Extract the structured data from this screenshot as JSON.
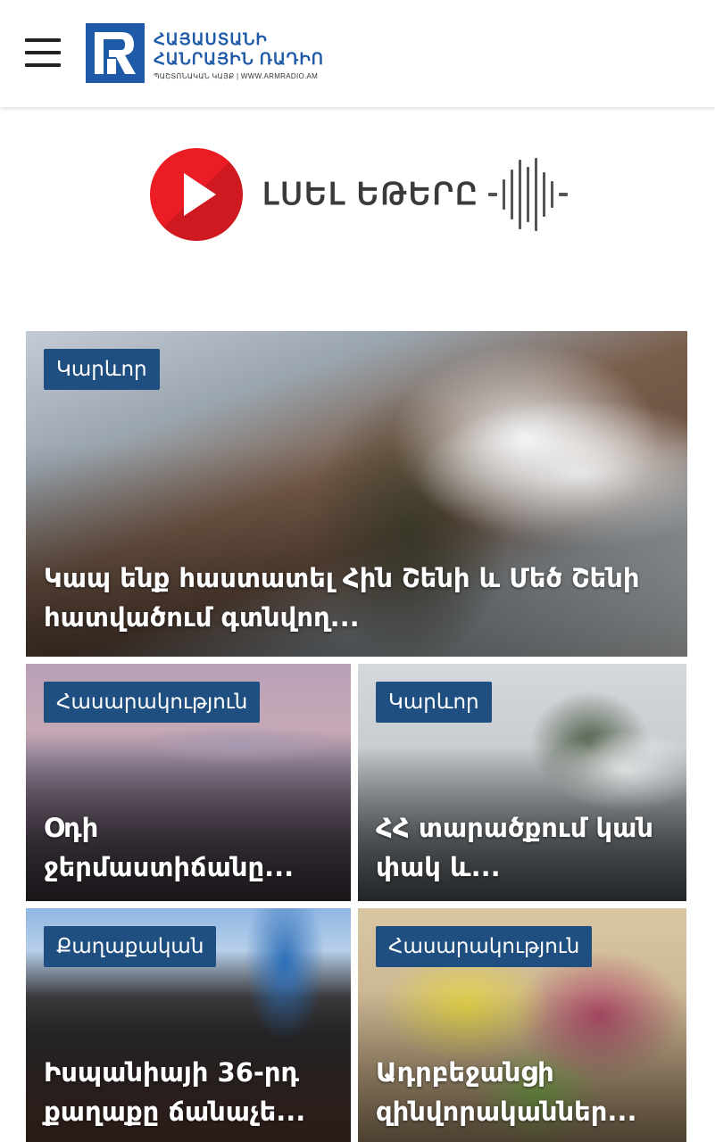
{
  "header": {
    "menu_icon": "hamburger-menu-icon",
    "logo": {
      "line1": "ՀԱՅԱՍՏԱՆԻ",
      "line2": "ՀԱՆՐԱՅԻՆ ՌԱԴԻՈ",
      "subline": "ՊԱՇՏՈՆԱԿԱՆ ԿԱՅՔ | WWW.ARMRADIO.AM",
      "brand_color": "#1e5aa8"
    }
  },
  "listen": {
    "label": "ԼՍԵԼ ԵԹԵՐԸ",
    "play_icon": "play-icon",
    "wave_icon": "audio-wave-icon",
    "accent_color": "#ec1c24"
  },
  "articles": [
    {
      "category": "Կարևոր",
      "title": "Կապ ենք հաստատել Հին Շենի և Մեծ Շենի հատվածում գտնվող..."
    },
    {
      "category": "Հասարակություն",
      "title": "Օդի ջերմաստիճանը..."
    },
    {
      "category": "Կարևոր",
      "title": "ՀՀ տարածքում կան փակ և..."
    },
    {
      "category": "Քաղաքական",
      "title": "Իսպանիայի 36-րդ քաղաքը ճանաչե..."
    },
    {
      "category": "Հասարակություն",
      "title": "Ադրբեջանցի զինվորականներ..."
    }
  ],
  "colors": {
    "badge_bg": "#1f4f80"
  }
}
